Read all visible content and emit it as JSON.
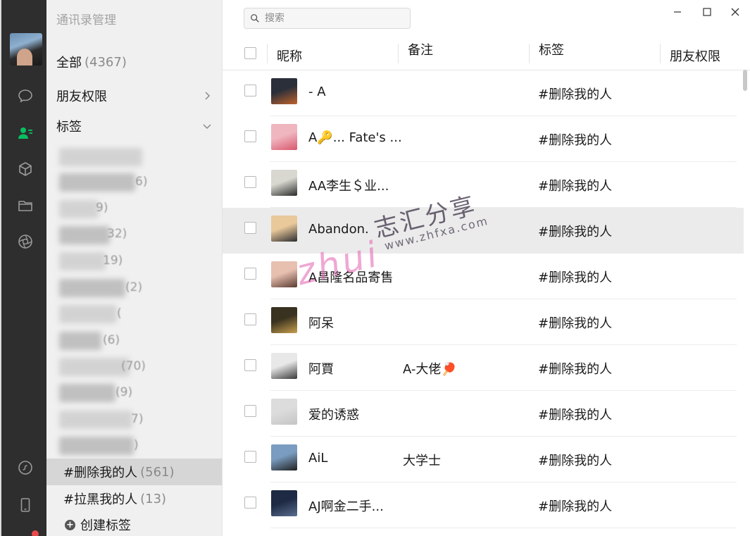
{
  "sidebar_panel": {
    "title": "通讯录管理",
    "all_label": "全部",
    "all_count": "(4367)",
    "friend_perm_label": "朋友权限",
    "tags_label": "标签",
    "blurred_suffixes": [
      "6)",
      "9)",
      "32)",
      "19)",
      "(2)",
      "(",
      "(6)",
      "(70)",
      "(9)",
      "7)",
      ")"
    ],
    "tags": [
      {
        "label": "#删除我的人",
        "count": "(561)",
        "selected": true
      },
      {
        "label": "#拉黑我的人",
        "count": "(13)",
        "selected": false
      }
    ],
    "create_tag_label": "创建标签"
  },
  "search": {
    "placeholder": "搜索"
  },
  "table": {
    "headers": {
      "nickname": "昵称",
      "remark": "备注",
      "tags": "标签",
      "friend_perm": "朋友权限"
    },
    "rows": [
      {
        "nickname": "- A",
        "remark": "",
        "tag": "#删除我的人",
        "avatar_colors": [
          "#2b2f3a",
          "#c0632c"
        ]
      },
      {
        "nickname": "A🔑... Fate's ...",
        "remark": "",
        "tag": "#删除我的人",
        "avatar_colors": [
          "#f0b6c0",
          "#d8586e"
        ]
      },
      {
        "nickname": "AA李生＄业...",
        "remark": "",
        "tag": "#删除我的人",
        "avatar_colors": [
          "#d8d8d0",
          "#2a2a2a"
        ]
      },
      {
        "nickname": "Abandon.",
        "remark": "",
        "tag": "#删除我的人",
        "avatar_colors": [
          "#e9c89a",
          "#2c2c30"
        ]
      },
      {
        "nickname": "A昌隆名品寄售",
        "remark": "",
        "tag": "#删除我的人",
        "avatar_colors": [
          "#e7c0b0",
          "#5a3a30"
        ]
      },
      {
        "nickname": "阿呆",
        "remark": "",
        "tag": "#删除我的人",
        "avatar_colors": [
          "#3a3220",
          "#c9a050"
        ]
      },
      {
        "nickname": "阿賈",
        "remark": "A-大佬🏓",
        "tag": "#删除我的人",
        "avatar_colors": [
          "#e8e8e8",
          "#3a3a3a"
        ]
      },
      {
        "nickname": "爱的诱惑",
        "remark": "",
        "tag": "#删除我的人",
        "avatar_colors": [
          "#dcdcdc",
          "#c4c4c4"
        ]
      },
      {
        "nickname": "AiL",
        "remark": "大学士",
        "tag": "#删除我的人",
        "avatar_colors": [
          "#7a9cc0",
          "#202020"
        ]
      },
      {
        "nickname": "AJ啊金二手...",
        "remark": "",
        "tag": "#删除我的人",
        "avatar_colors": [
          "#1e2a44",
          "#5a6e8e"
        ]
      }
    ]
  },
  "watermark": {
    "latin": "zhui",
    "cn": "志汇分享",
    "url": "www.zhfxa.com"
  },
  "colors": {
    "rail": "#2e2e2e",
    "panel": "#f0f0f0",
    "accent_green": "#07c160",
    "badge_red": "#e84a4a"
  }
}
